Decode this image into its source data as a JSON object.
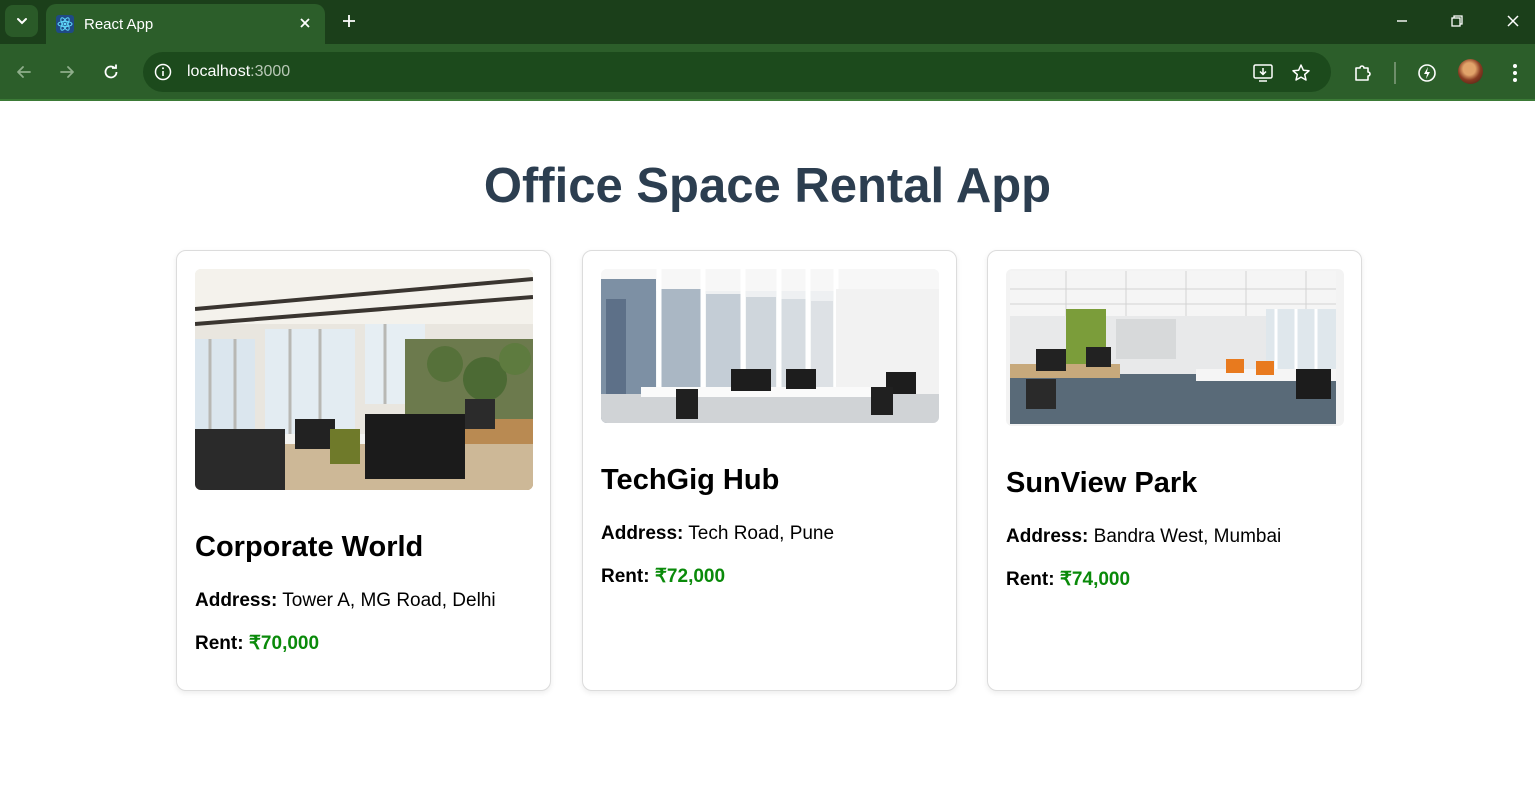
{
  "browser": {
    "tab_title": "React App",
    "url_host": "localhost",
    "url_port": ":3000"
  },
  "page": {
    "title": "Office Space Rental App"
  },
  "offices": [
    {
      "name": "Corporate World",
      "address_label": "Address:",
      "address": "Tower A, MG Road, Delhi",
      "rent_label": "Rent:",
      "rent": "₹70,000"
    },
    {
      "name": "TechGig Hub",
      "address_label": "Address:",
      "address": "Tech Road, Pune",
      "rent_label": "Rent:",
      "rent": "₹72,000"
    },
    {
      "name": "SunView Park",
      "address_label": "Address:",
      "address": "Bandra West, Mumbai",
      "rent_label": "Rent:",
      "rent": "₹74,000"
    }
  ],
  "colors": {
    "chrome": "#2c5e2a",
    "title": "#2c3e50",
    "rent": "#0a8a0a"
  }
}
